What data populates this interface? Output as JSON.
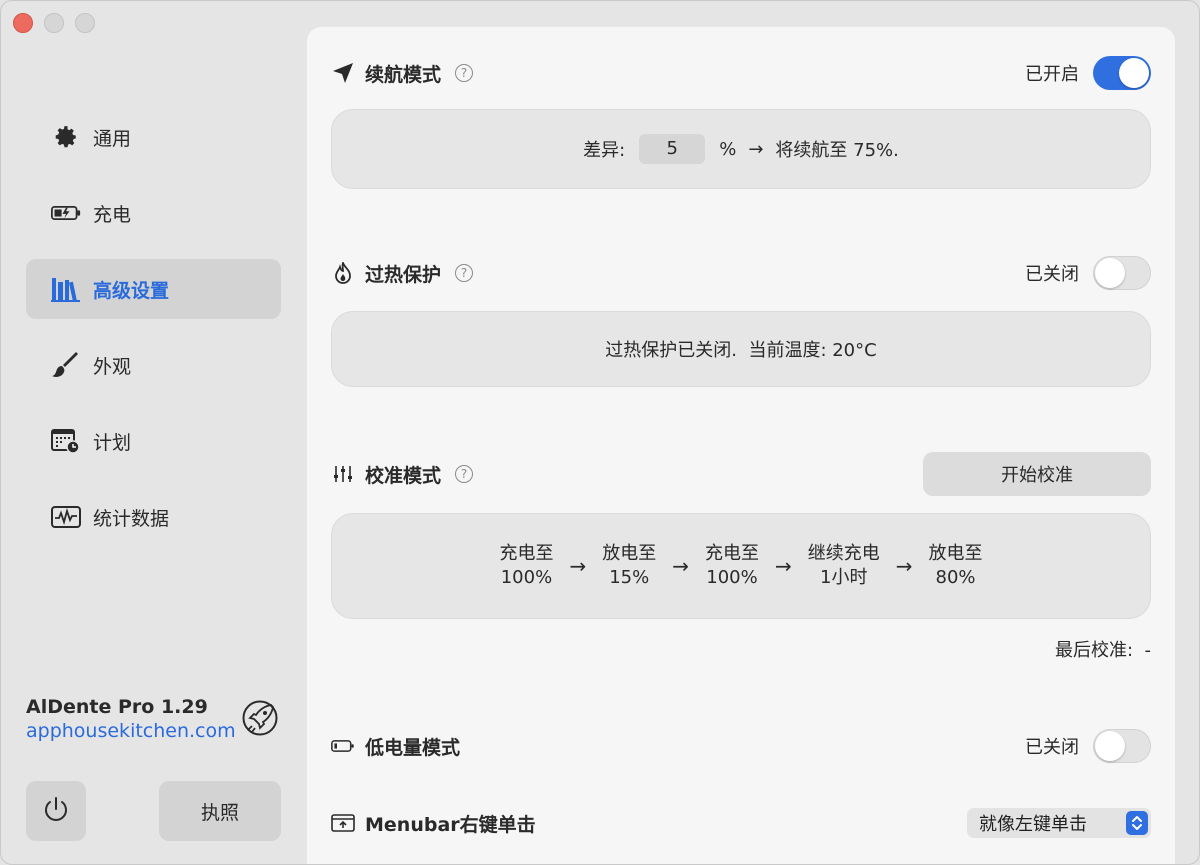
{
  "sidebar": {
    "items": [
      {
        "label": "通用",
        "icon": "gear-icon"
      },
      {
        "label": "充电",
        "icon": "battery-charging-icon"
      },
      {
        "label": "高级设置",
        "icon": "books-icon"
      },
      {
        "label": "外观",
        "icon": "paintbrush-icon"
      },
      {
        "label": "计划",
        "icon": "calendar-clock-icon"
      },
      {
        "label": "统计数据",
        "icon": "waveform-icon"
      }
    ],
    "active_item": "高级设置",
    "brand_name": "AlDente Pro 1.29",
    "brand_link": "apphousekitchen.com",
    "license_label": "执照"
  },
  "sailing": {
    "title": "续航模式",
    "status": "已开启",
    "enabled": true,
    "diff_label": "差异:",
    "diff_value": "5",
    "percent_sign": "%",
    "arrow": "→",
    "result_text": "将续航至 75%."
  },
  "heat": {
    "title": "过热保护",
    "status": "已关闭",
    "enabled": false,
    "info_text": "过热保护已关闭.  当前温度: 20°C"
  },
  "calibration": {
    "title": "校准模式",
    "button_label": "开始校准",
    "steps": [
      {
        "line1": "充电至",
        "line2": "100%"
      },
      {
        "line1": "放电至",
        "line2": "15%"
      },
      {
        "line1": "充电至",
        "line2": "100%"
      },
      {
        "line1": "继续充电",
        "line2": "1小时"
      },
      {
        "line1": "放电至",
        "line2": "80%"
      }
    ],
    "arrow": "→",
    "last_label": "最后校准:  -"
  },
  "low_power": {
    "title": "低电量模式",
    "status": "已关闭",
    "enabled": false
  },
  "menubar": {
    "title": "Menubar右键单击",
    "selected_option": "就像左键单击"
  },
  "colors": {
    "accent": "#2f6fe0",
    "link": "#2a6bdc",
    "close": "#ed6a5e"
  }
}
